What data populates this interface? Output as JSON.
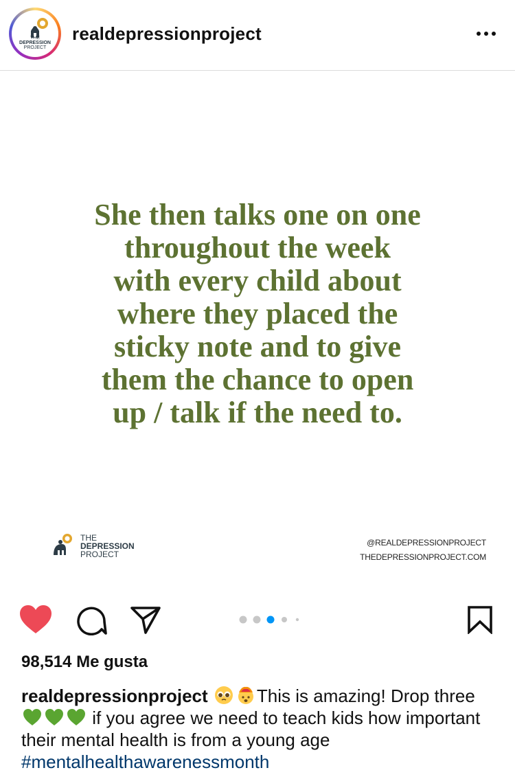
{
  "header": {
    "avatar_text": [
      "THE",
      "DEPRESSION",
      "PROJECT"
    ],
    "username": "realdepressionproject"
  },
  "post": {
    "quote_lines": [
      "She then talks one on one",
      "throughout the week",
      "with every child about",
      "where they placed the",
      "sticky note and to give",
      "them the chance to open",
      "up / talk if the need to."
    ],
    "brand_left": [
      "THE",
      "DEPRESSION",
      "PROJECT"
    ],
    "brand_right": [
      "@REALDEPRESSIONPROJECT",
      "THEDEPRESSIONPROJECT.COM"
    ],
    "carousel": {
      "count": 5,
      "active_index": 2
    }
  },
  "likes": {
    "text": "98,514 Me gusta"
  },
  "caption": {
    "username": "realdepressionproject",
    "emoji_1": "pleading-face",
    "emoji_2": "exploding-head",
    "text_1": "This is amazing! Drop three",
    "emoji_hearts": "green-heart",
    "text_2": " if you agree we need to teach kids how important their mental health is from a young age ",
    "hashtag": "#mentalhealthawarenessmonth"
  },
  "colors": {
    "quote_green": "#5d7232",
    "like_red": "#ed4956",
    "hashtag_blue": "#00376b",
    "carousel_active": "#0095f6",
    "brand_gold": "#e3a72f"
  }
}
